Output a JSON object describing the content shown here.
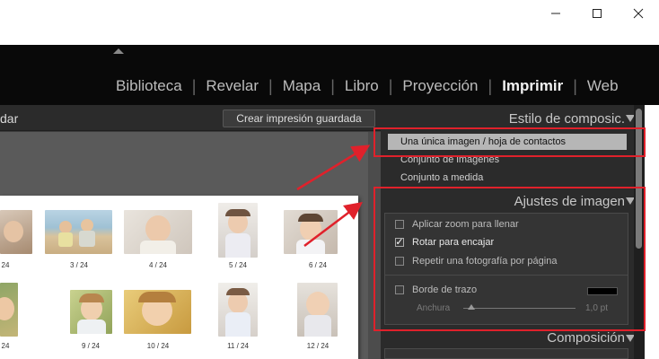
{
  "window": {
    "minimize_icon": "minimize-icon",
    "maximize_icon": "maximize-icon",
    "close_icon": "close-icon"
  },
  "modules": [
    {
      "label": "Biblioteca",
      "active": false
    },
    {
      "label": "Revelar",
      "active": false
    },
    {
      "label": "Mapa",
      "active": false
    },
    {
      "label": "Libro",
      "active": false
    },
    {
      "label": "Proyección",
      "active": false
    },
    {
      "label": "Imprimir",
      "active": true
    },
    {
      "label": "Web",
      "active": false
    }
  ],
  "left": {
    "header_title_fragment": "dar",
    "save_button_label": "Crear impresión guardada"
  },
  "contact_sheet": {
    "row1": [
      "24",
      "3 / 24",
      "4 / 24",
      "5 / 24",
      "6 / 24"
    ],
    "row2": [
      "24",
      "9 / 24",
      "10 / 24",
      "11 / 24",
      "12 / 24"
    ]
  },
  "right_panel": {
    "layout_style_header": "Estilo de composic.",
    "layout_styles": [
      {
        "label": "Una única imagen / hoja de contactos",
        "selected": true
      },
      {
        "label": "Conjunto de imágenes",
        "selected": false
      },
      {
        "label": "Conjunto a medida",
        "selected": false
      }
    ],
    "image_settings_header": "Ajustes de imagen",
    "options": [
      {
        "label": "Aplicar zoom para llenar",
        "checked": false
      },
      {
        "label": "Rotar para encajar",
        "checked": true
      },
      {
        "label": "Repetir una fotografía por página",
        "checked": false
      }
    ],
    "stroke_border": {
      "label": "Borde de trazo",
      "checked": false,
      "color": "#000000"
    },
    "width": {
      "label": "Anchura",
      "value": "1,0 pt",
      "slider_fraction": 0.03
    },
    "layout_header": "Composición"
  },
  "colors": {
    "module_active": "#f2f2f2",
    "selected_row": "#b6b6b6",
    "annotation_red": "#e0212b"
  }
}
